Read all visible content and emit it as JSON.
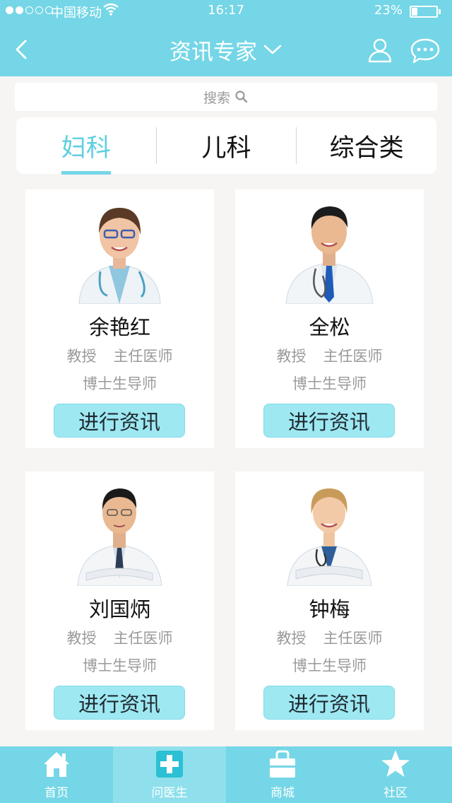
{
  "status_bar": {
    "carrier": "中国移动",
    "time": "16:17",
    "battery": "23%",
    "battery_level": 0.23,
    "signal_bars_filled": 2,
    "signal_bars_total": 5
  },
  "nav": {
    "title": "资讯专家",
    "back_icon": "chevron-left-icon",
    "dropdown_icon": "chevron-down-icon",
    "user_icon": "user-icon",
    "message_icon": "chat-bubble-icon"
  },
  "search": {
    "placeholder": "搜索",
    "icon": "search-icon"
  },
  "tabs": [
    {
      "label": "妇科",
      "active": true
    },
    {
      "label": "儿科",
      "active": false
    },
    {
      "label": "综合类",
      "active": false
    }
  ],
  "experts": [
    {
      "name": "余艳红",
      "rank": "教授",
      "position": "主任医师",
      "supervisor": "博士生导师",
      "button": "进行资讯"
    },
    {
      "name": "全松",
      "rank": "教授",
      "position": "主任医师",
      "supervisor": "博士生导师",
      "button": "进行资讯"
    },
    {
      "name": "刘国炳",
      "rank": "教授",
      "position": "主任医师",
      "supervisor": "博士生导师",
      "button": "进行资讯"
    },
    {
      "name": "钟梅",
      "rank": "教授",
      "position": "主任医师",
      "supervisor": "博士生导师",
      "button": "进行资讯"
    }
  ],
  "tabbar": [
    {
      "label": "首页",
      "icon": "home-icon",
      "active": false
    },
    {
      "label": "问医生",
      "icon": "medical-cross-icon",
      "active": true
    },
    {
      "label": "商城",
      "icon": "shopping-bag-icon",
      "active": false
    },
    {
      "label": "社区",
      "icon": "star-icon",
      "active": false
    }
  ],
  "colors": {
    "accent": "#74d6e6",
    "button": "#9ee8f2",
    "active_tab_text": "#5fcfdf",
    "background": "#f7f4f4"
  }
}
